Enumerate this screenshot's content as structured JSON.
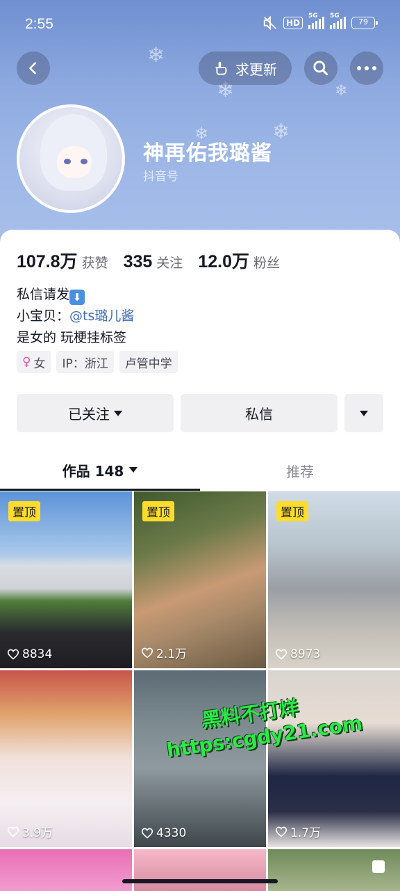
{
  "status_bar": {
    "time": "2:55",
    "hd_label": "HD",
    "signal1_tag": "5G",
    "signal2_tag": "5G",
    "battery": "79"
  },
  "header": {
    "request_update_label": "求更新",
    "back_icon": "chevron-left-icon",
    "search_icon": "search-icon",
    "more_icon": "more-dots-icon"
  },
  "profile": {
    "nickname": "神再佑我璐酱",
    "douyin_id_label": "抖音号"
  },
  "stats": [
    {
      "value": "107.8万",
      "label": "获赞"
    },
    {
      "value": "335",
      "label": "关注"
    },
    {
      "value": "12.0万",
      "label": "粉丝"
    }
  ],
  "bio": {
    "line1": "私信请发",
    "line1_emoji": "⬇",
    "line2_prefix": "小宝贝：",
    "line2_mention": "@ts璐儿酱",
    "line3": "是女的 玩梗挂标签"
  },
  "tags": {
    "gender_icon": "♀",
    "gender": "女",
    "ip": "IP：浙江",
    "school": "卢管中学"
  },
  "actions": {
    "follow_label": "已关注",
    "message_label": "私信"
  },
  "tabs": {
    "works_label": "作品 148",
    "recommend_label": "推荐"
  },
  "videos": [
    {
      "pinned": "置顶",
      "likes": "8834"
    },
    {
      "pinned": "置顶",
      "likes": "2.1万"
    },
    {
      "pinned": "置顶",
      "likes": "8973"
    },
    {
      "pinned": "",
      "likes": "3.9万"
    },
    {
      "pinned": "",
      "likes": "4330"
    },
    {
      "pinned": "",
      "likes": "1.7万"
    }
  ],
  "watermark": {
    "line1": "黑料不打烊",
    "line2": "https:cgdy21.com"
  },
  "colors": {
    "pin_badge": "#fedc2b",
    "mention": "#3d6ab5",
    "banner_top": "#6f8fd0"
  }
}
